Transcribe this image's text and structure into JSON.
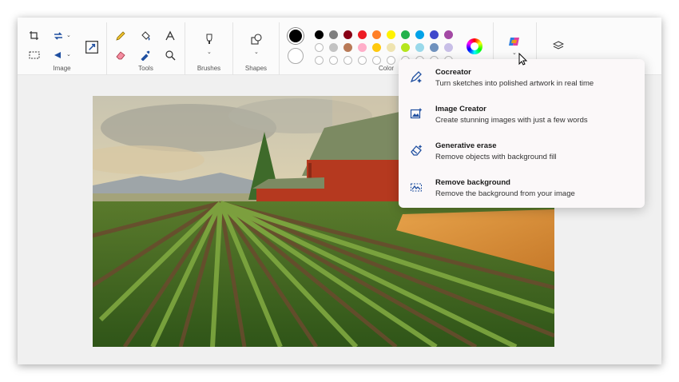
{
  "ribbon": {
    "groups": {
      "image": "Image",
      "tools": "Tools",
      "brushes": "Brushes",
      "shapes": "Shapes",
      "color": "Color"
    },
    "icons": [
      "crop-icon",
      "rotate-icon",
      "select-icon",
      "flip-icon",
      "resize-icon",
      "pencil-icon",
      "fill-icon",
      "text-icon",
      "eraser-icon",
      "color-picker-icon",
      "magnifier-icon",
      "brush-icon",
      "shapes-icon",
      "color-wheel-icon",
      "copilot-icon",
      "layers-icon"
    ],
    "colors": {
      "primary": "#000000",
      "secondary": "#ffffff",
      "palette_row1": [
        "#000000",
        "#7f7f7f",
        "#880015",
        "#ed1c24",
        "#ff7f27",
        "#fff200",
        "#22b14c",
        "#00a2e8",
        "#3f48cc",
        "#a349a4"
      ],
      "palette_row2": [
        "#ffffff",
        "#c3c3c3",
        "#b97a57",
        "#ffaec9",
        "#ffc90e",
        "#efe4b0",
        "#b5e61d",
        "#99d9ea",
        "#7092be",
        "#c8bfe7"
      ]
    }
  },
  "copilot_menu": {
    "items": [
      {
        "title": "Cocreator",
        "description": "Turn sketches into polished artwork in real time",
        "icon": "cocreator-brush-icon"
      },
      {
        "title": "Image Creator",
        "description": "Create stunning images with just a few words",
        "icon": "image-creator-icon"
      },
      {
        "title": "Generative erase",
        "description": "Remove objects with background fill",
        "icon": "generative-erase-icon"
      },
      {
        "title": "Remove background",
        "description": "Remove the background from your image",
        "icon": "remove-background-icon"
      }
    ]
  },
  "canvas": {
    "image_subject": "farm-landscape-painting"
  }
}
